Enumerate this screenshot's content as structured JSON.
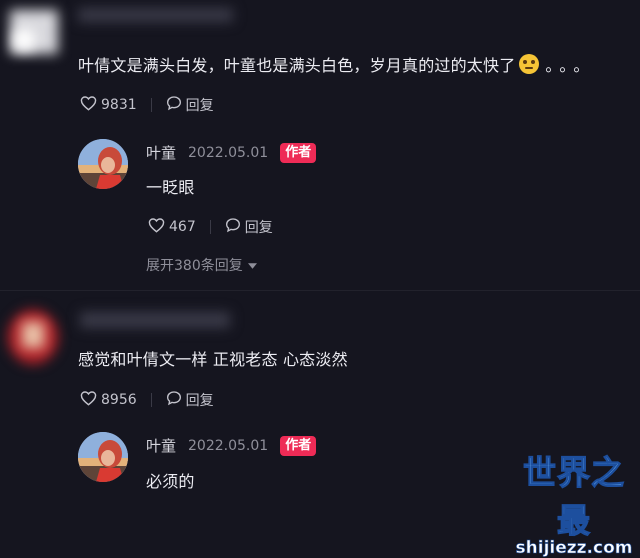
{
  "comments": [
    {
      "text": "叶倩文是满头白发，叶童也是满头白色，岁月真的过的太快了",
      "tail": "。。。",
      "likes": "9831",
      "reply_label": "回复",
      "reply": {
        "name": "叶童",
        "date": "2022.05.01",
        "badge": "作者",
        "text": "一眨眼",
        "likes": "467",
        "reply_label": "回复",
        "expand_label": "展开380条回复"
      }
    },
    {
      "text": "感觉和叶倩文一样 正视老态 心态淡然",
      "likes": "8956",
      "reply_label": "回复",
      "reply": {
        "name": "叶童",
        "date": "2022.05.01",
        "badge": "作者",
        "text": "必须的"
      }
    }
  ],
  "watermark": {
    "title": "世界之最",
    "subtitle": "shijiezz.com"
  },
  "colors": {
    "background": "#15151f",
    "badge": "#ee2b56",
    "text": "#ececf2",
    "muted": "#8f8f9a"
  },
  "icons": [
    "heart-icon",
    "comment-icon",
    "chevron-down-icon",
    "emoji-icon"
  ]
}
